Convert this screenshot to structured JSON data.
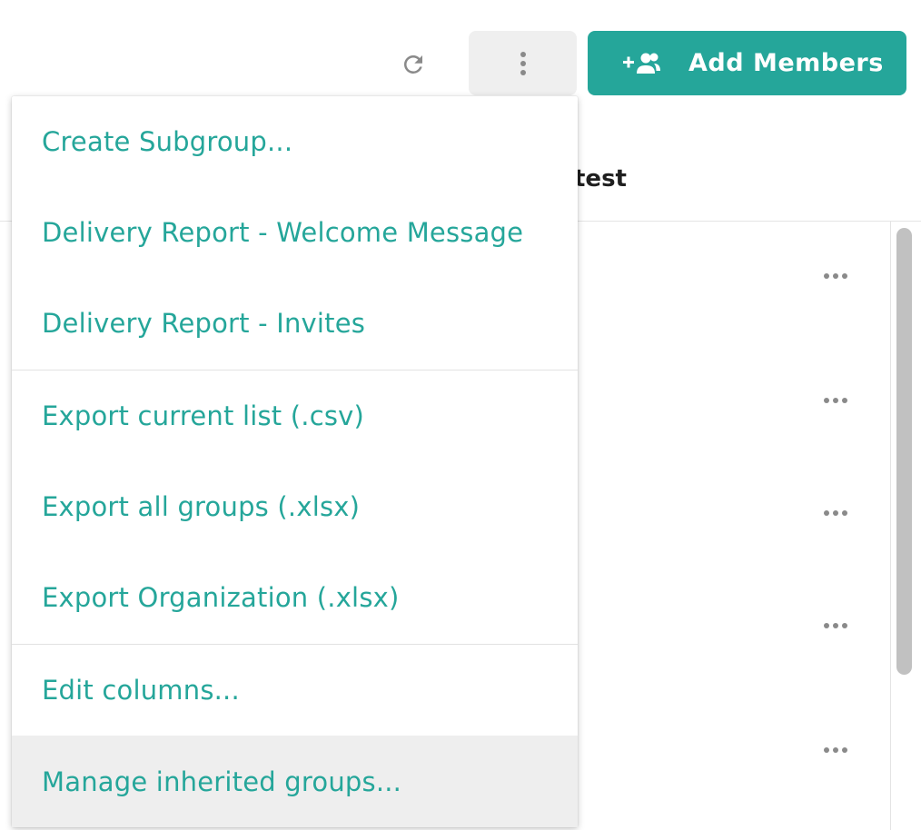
{
  "toolbar": {
    "refresh_icon": "refresh-icon",
    "more_icon": "more-vertical-icon",
    "add_members": {
      "icon": "add-group-icon",
      "label": "Add Members"
    }
  },
  "table": {
    "visible_column_header": "test",
    "row_menu_icon": "more-horizontal-icon",
    "row_count_visible": 5
  },
  "menu": {
    "sections": [
      {
        "items": [
          {
            "label": "Create Subgroup..."
          },
          {
            "label": "Delivery Report - Welcome Message"
          },
          {
            "label": "Delivery Report - Invites"
          }
        ]
      },
      {
        "items": [
          {
            "label": "Export current list (.csv)"
          },
          {
            "label": "Export all groups (.xlsx)"
          },
          {
            "label": "Export Organization (.xlsx)"
          }
        ]
      },
      {
        "items": [
          {
            "label": "Edit columns..."
          },
          {
            "label": "Manage inherited groups...",
            "highlighted": true
          }
        ]
      }
    ]
  },
  "colors": {
    "accent": "#25a69a",
    "menu_hover_bg": "#eeeeee",
    "icon_gray": "#8a8a8a"
  }
}
